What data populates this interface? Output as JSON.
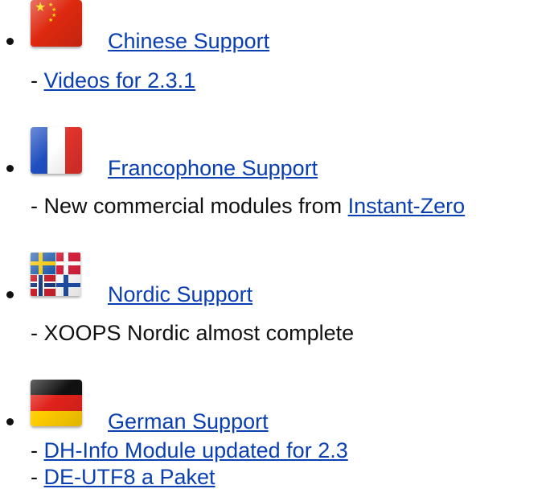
{
  "items": [
    {
      "icon": "china-flag-icon",
      "title": "Chinese Support",
      "lines": [
        {
          "prefix": "- ",
          "link": "Videos for 2.3.1"
        }
      ]
    },
    {
      "icon": "france-flag-icon",
      "title": "Francophone Support",
      "lines": [
        {
          "prefix": "- New commercial modules from ",
          "link": "Instant-Zero"
        }
      ]
    },
    {
      "icon": "nordic-flags-icon",
      "title": "Nordic Support",
      "lines": [
        {
          "prefix": "- XOOPS Nordic almost complete"
        }
      ]
    },
    {
      "icon": "germany-flag-icon",
      "title": "German Support",
      "lines": [
        {
          "prefix": "- ",
          "link": "DH-Info Module updated for 2.3"
        },
        {
          "prefix": "- ",
          "link": "DE-UTF8 a Paket"
        }
      ]
    }
  ],
  "colors": {
    "link": "#0a3fb3",
    "text": "#111111",
    "background": "#ffffff"
  }
}
